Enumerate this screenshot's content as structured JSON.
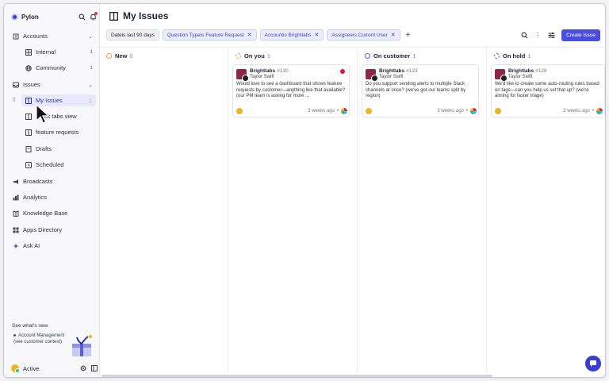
{
  "app": {
    "name": "Pylon"
  },
  "sidebar": {
    "items": [
      {
        "label": "Accounts",
        "icon": "building-icon",
        "expanded": true
      },
      {
        "label": "Internal",
        "icon": "table-icon",
        "count": "1"
      },
      {
        "label": "Community",
        "icon": "globe-icon",
        "count": "1"
      },
      {
        "label": "Issues",
        "icon": "inbox-icon",
        "expanded": true
      },
      {
        "label": "My Issues",
        "icon": "kanban-icon",
        "active": true
      },
      {
        "label": "Slack tabs view",
        "icon": "kanban-icon"
      },
      {
        "label": "feature requests",
        "icon": "kanban-icon"
      },
      {
        "label": "Drafts",
        "icon": "draft-icon"
      },
      {
        "label": "Scheduled",
        "icon": "clock-icon"
      },
      {
        "label": "Broadcasts",
        "icon": "megaphone-icon"
      },
      {
        "label": "Analytics",
        "icon": "chart-icon"
      },
      {
        "label": "Knowledge Base",
        "icon": "book-icon"
      },
      {
        "label": "Apps Directory",
        "icon": "grid-icon"
      },
      {
        "label": "Ask AI",
        "icon": "sparkle-icon"
      }
    ],
    "whats_new_title": "See what's new",
    "whats_new_item": "Account Management (see customer context)",
    "user_status": "Active"
  },
  "main": {
    "title": "My Issues",
    "filters": [
      {
        "prefix": "Date",
        "text": " is last 90 days",
        "style": "plain"
      },
      {
        "prefix": "Question Type",
        "text": " is Feature Request",
        "style": "blue"
      },
      {
        "prefix": "Account",
        "text": " is Brightlabs",
        "style": "blue"
      },
      {
        "prefix": "Assignee",
        "text": " is Current User",
        "style": "blue"
      }
    ],
    "create_button": "Create Issue",
    "columns": [
      {
        "name": "New",
        "count": "0",
        "color": "#e8a33d",
        "cards": []
      },
      {
        "name": "On you",
        "count": "1",
        "color": "#e8a33d",
        "cards": [
          {
            "company": "Brightlabs",
            "number": "#130",
            "person": "Taylor Swift",
            "urgent": true,
            "body": "Would love to see a dashboard that shows feature requests by customer—anything like that available? (our PM team is asking for more ...",
            "time": "3 weeks ago"
          }
        ]
      },
      {
        "name": "On customer",
        "count": "1",
        "color": "#5a5fd8",
        "cards": [
          {
            "company": "Brightlabs",
            "number": "#123",
            "person": "Taylor Swift",
            "urgent": false,
            "body": "Do you support sending alerts to multiple Slack channels at once? (we've got our teams split by region)",
            "time": "3 weeks ago"
          }
        ]
      },
      {
        "name": "On hold",
        "count": "1",
        "color": "#5a5fd8",
        "cards": [
          {
            "company": "Brightlabs",
            "number": "#126",
            "person": "Taylor Swift",
            "urgent": false,
            "body": "We'd like to create some auto-routing rules based on tags—can you help us set that up? (we're aiming for faster triage)",
            "time": "3 weeks ago"
          }
        ]
      }
    ]
  },
  "colors": {
    "accent": "#4a4ee0",
    "active_bg": "#e7e8fb",
    "urgent": "#d71f2c",
    "company_logo": "#8c2744"
  }
}
